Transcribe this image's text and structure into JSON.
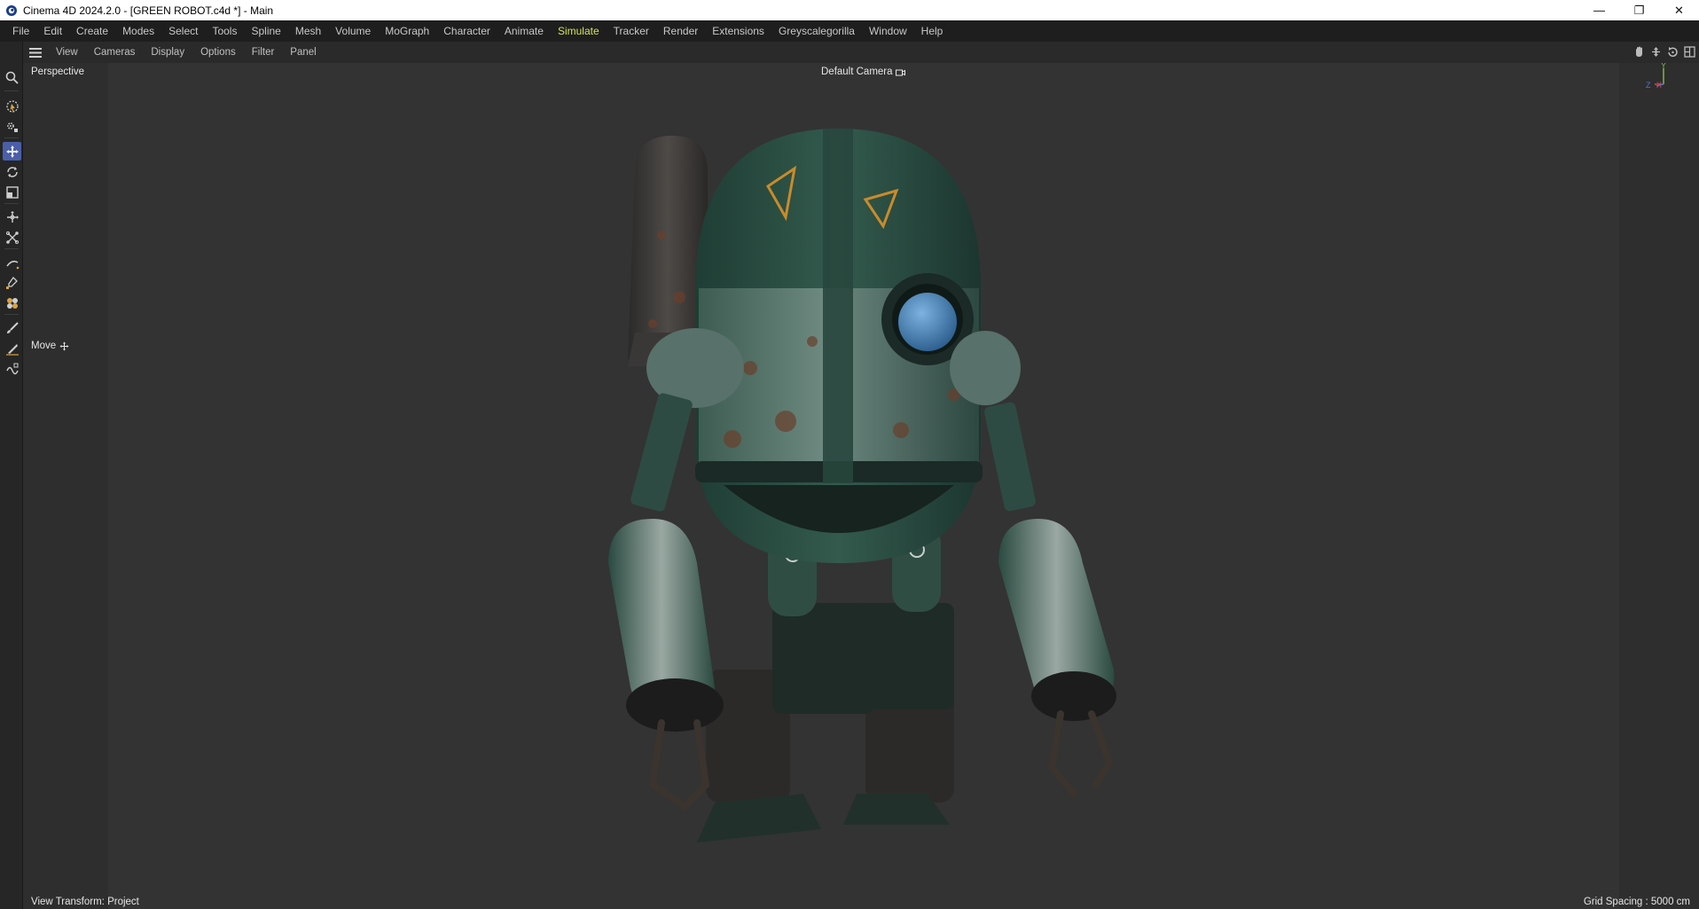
{
  "window": {
    "title": "Cinema 4D 2024.2.0 - [GREEN ROBOT.c4d *] - Main",
    "minimize": "—",
    "maximize": "❐",
    "close": "✕"
  },
  "menu": {
    "items": [
      {
        "label": "File"
      },
      {
        "label": "Edit"
      },
      {
        "label": "Create"
      },
      {
        "label": "Modes"
      },
      {
        "label": "Select"
      },
      {
        "label": "Tools"
      },
      {
        "label": "Spline"
      },
      {
        "label": "Mesh"
      },
      {
        "label": "Volume"
      },
      {
        "label": "MoGraph"
      },
      {
        "label": "Character"
      },
      {
        "label": "Animate"
      },
      {
        "label": "Simulate"
      },
      {
        "label": "Tracker"
      },
      {
        "label": "Render"
      },
      {
        "label": "Extensions"
      },
      {
        "label": "Greyscalegorilla"
      },
      {
        "label": "Window"
      },
      {
        "label": "Help"
      }
    ],
    "highlight_color": "#d4e35a"
  },
  "viewport_menu": {
    "items": [
      {
        "label": "View"
      },
      {
        "label": "Cameras"
      },
      {
        "label": "Display"
      },
      {
        "label": "Options"
      },
      {
        "label": "Filter"
      },
      {
        "label": "Panel"
      }
    ],
    "nav_icons": [
      "pan-icon",
      "dolly-icon",
      "rotate-icon",
      "maximize-viewport-icon"
    ]
  },
  "tools": [
    "search-icon",
    "live-selection-icon",
    "settings-tool-icon",
    "move-tool-icon",
    "rotate-tool-icon",
    "scale-tool-icon",
    "transfer-icon",
    "snap-icon",
    "spline-pen-icon",
    "spline-paint-icon",
    "sculpt-icon",
    "brush-icon",
    "knife-icon",
    "weld-icon"
  ],
  "viewport": {
    "projection": "Perspective",
    "camera": "Default Camera",
    "active_tool": "Move",
    "view_transform": "View Transform: Project",
    "grid_spacing": "Grid Spacing : 5000 cm",
    "accent": "#4a5fa8"
  }
}
